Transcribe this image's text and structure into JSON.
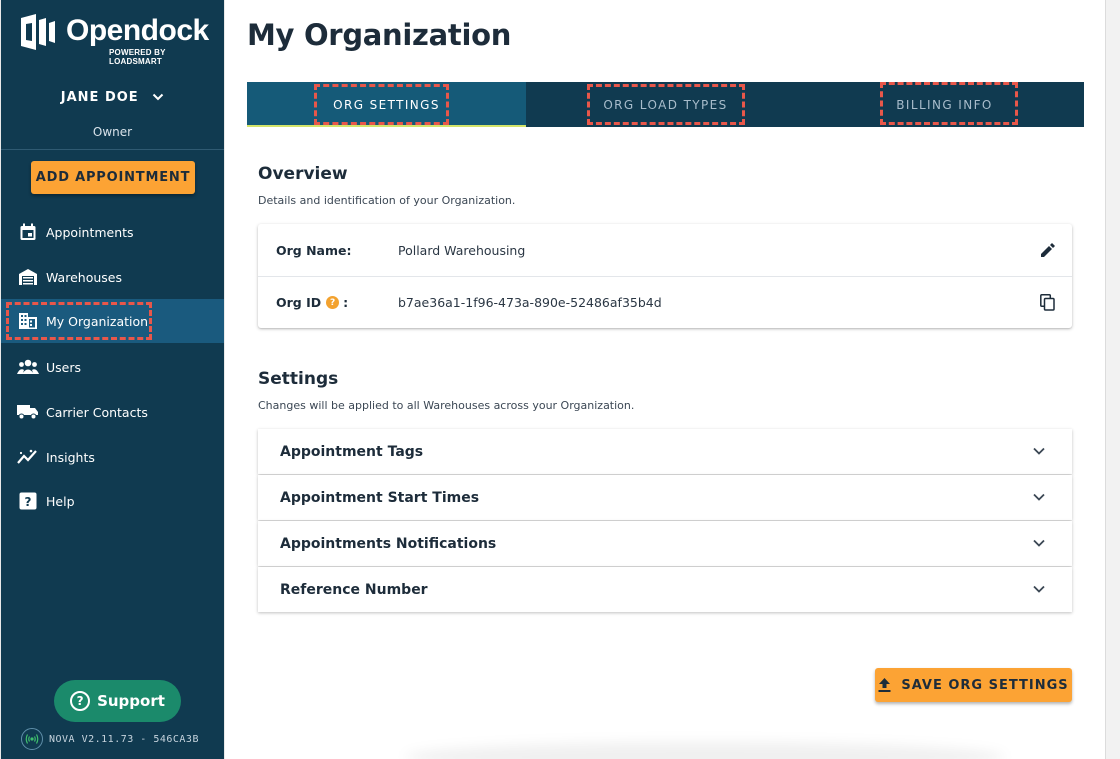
{
  "brand": {
    "name": "Opendock",
    "tagline": "POWERED BY LOADSMART"
  },
  "user": {
    "name": "JANE DOE",
    "role": "Owner"
  },
  "sidebar": {
    "add_button": "ADD APPOINTMENT",
    "items": [
      {
        "label": "Appointments",
        "icon": "calendar-icon"
      },
      {
        "label": "Warehouses",
        "icon": "warehouse-icon"
      },
      {
        "label": "My Organization",
        "icon": "building-icon",
        "active": true
      },
      {
        "label": "Users",
        "icon": "users-icon"
      },
      {
        "label": "Carrier Contacts",
        "icon": "truck-icon"
      },
      {
        "label": "Insights",
        "icon": "insights-icon"
      },
      {
        "label": "Help",
        "icon": "help-icon"
      }
    ],
    "support_label": "Support",
    "version": "NOVA V2.11.73 - 546CA3B"
  },
  "page": {
    "title": "My Organization"
  },
  "tabs": [
    {
      "label": "ORG SETTINGS",
      "active": true
    },
    {
      "label": "ORG LOAD TYPES",
      "active": false
    },
    {
      "label": "BILLING INFO",
      "active": false
    }
  ],
  "overview": {
    "title": "Overview",
    "subtitle": "Details and identification of your Organization.",
    "org_name_label": "Org Name:",
    "org_name_value": "Pollard Warehousing",
    "org_id_label": "Org ID",
    "org_id_colon": ":",
    "org_id_value": "b7ae36a1-1f96-473a-890e-52486af35b4d"
  },
  "settings": {
    "title": "Settings",
    "subtitle": "Changes will be applied to all Warehouses across your Organization.",
    "panels": [
      "Appointment Tags",
      "Appointment Start Times",
      "Appointments Notifications",
      "Reference Number"
    ]
  },
  "save_button": "SAVE ORG SETTINGS",
  "colors": {
    "sidebar_bg": "#103a50",
    "active_nav": "#1a5a7e",
    "accent_orange": "#fca334",
    "support_green": "#1b8a6b",
    "highlight_red": "#e8574a"
  }
}
